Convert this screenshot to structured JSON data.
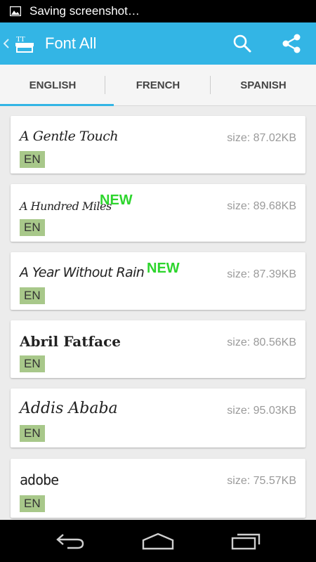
{
  "status": {
    "text": "Saving screenshot…",
    "icon": "image-icon"
  },
  "actionbar": {
    "title": "Font All",
    "bg": "#33b5e5"
  },
  "tabs": [
    {
      "label": "ENGLISH",
      "selected": true
    },
    {
      "label": "FRENCH",
      "selected": false
    },
    {
      "label": "SPANISH",
      "selected": false
    }
  ],
  "fonts": [
    {
      "name": "A Gentle Touch",
      "size": "size: 87.02KB",
      "lang": "EN",
      "new": ""
    },
    {
      "name": "A Hundred Miles",
      "size": "size: 89.68KB",
      "lang": "EN",
      "new": "NEW"
    },
    {
      "name": "A Year Without Rain",
      "size": "size: 87.39KB",
      "lang": "EN",
      "new": "NEW"
    },
    {
      "name": "Abril Fatface",
      "size": "size: 80.56KB",
      "lang": "EN",
      "new": ""
    },
    {
      "name": "Addis Ababa",
      "size": "size: 95.03KB",
      "lang": "EN",
      "new": ""
    },
    {
      "name": "adobe",
      "size": "size: 75.57KB",
      "lang": "EN",
      "new": ""
    }
  ],
  "colors": {
    "accent": "#33b5e5",
    "new_badge": "#2dd52d",
    "lang_badge": "#a8c88a"
  }
}
